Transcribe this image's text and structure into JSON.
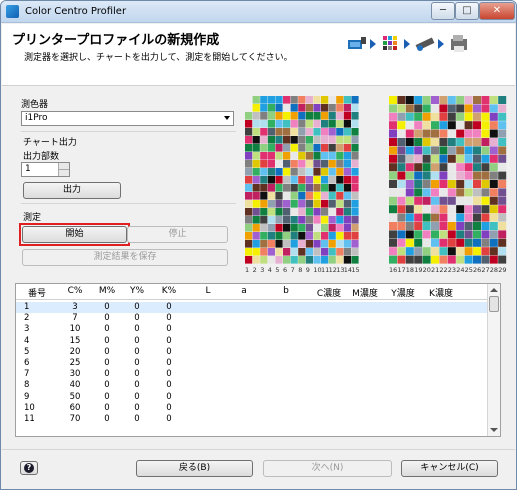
{
  "window": {
    "title": "Color Centro Profiler",
    "minimize": "─",
    "maximize": "□",
    "close": "✕"
  },
  "header": {
    "title": "プリンタープロファイルの新規作成",
    "subtitle": "測定器を選択し、チャートを出力して、測定を開始してください。",
    "step_icons": [
      "instrument-icon",
      "chart-icon",
      "measure-icon",
      "printer-icon"
    ]
  },
  "left": {
    "instrument_label": "測色器",
    "instrument_value": "i1Pro",
    "chart_output_label": "チャート出力",
    "copies_label": "出力部数",
    "copies_value": "1",
    "output_button": "出力",
    "measure_label": "測定",
    "start_button": "開始",
    "stop_button": "停止",
    "save_button": "測定結果を保存"
  },
  "chart_labels": {
    "left": [
      "1",
      "2",
      "3",
      "4",
      "5",
      "6",
      "7",
      "8",
      "9",
      "10",
      "11",
      "12",
      "13",
      "14",
      "15"
    ],
    "right": [
      "16",
      "17",
      "18",
      "19",
      "20",
      "21",
      "22",
      "23",
      "24",
      "25",
      "26",
      "27",
      "28",
      "29"
    ]
  },
  "table": {
    "headers": [
      "番号",
      "C%",
      "M%",
      "Y%",
      "K%",
      "L",
      "a",
      "b",
      "C濃度",
      "M濃度",
      "Y濃度",
      "K濃度"
    ],
    "rows": [
      [
        "1",
        "3",
        "0",
        "0",
        "0"
      ],
      [
        "2",
        "7",
        "0",
        "0",
        "0"
      ],
      [
        "3",
        "10",
        "0",
        "0",
        "0"
      ],
      [
        "4",
        "15",
        "0",
        "0",
        "0"
      ],
      [
        "5",
        "20",
        "0",
        "0",
        "0"
      ],
      [
        "6",
        "25",
        "0",
        "0",
        "0"
      ],
      [
        "7",
        "30",
        "0",
        "0",
        "0"
      ],
      [
        "8",
        "40",
        "0",
        "0",
        "0"
      ],
      [
        "9",
        "50",
        "0",
        "0",
        "0"
      ],
      [
        "10",
        "60",
        "0",
        "0",
        "0"
      ],
      [
        "11",
        "70",
        "0",
        "0",
        "0"
      ]
    ]
  },
  "footer": {
    "help": "?",
    "back_button": "戻る(B)",
    "next_button": "次へ(N)",
    "cancel_button": "キャンセル(C)"
  },
  "colors": {
    "highlight": "#e02020",
    "accent": "#1a5fb4"
  }
}
